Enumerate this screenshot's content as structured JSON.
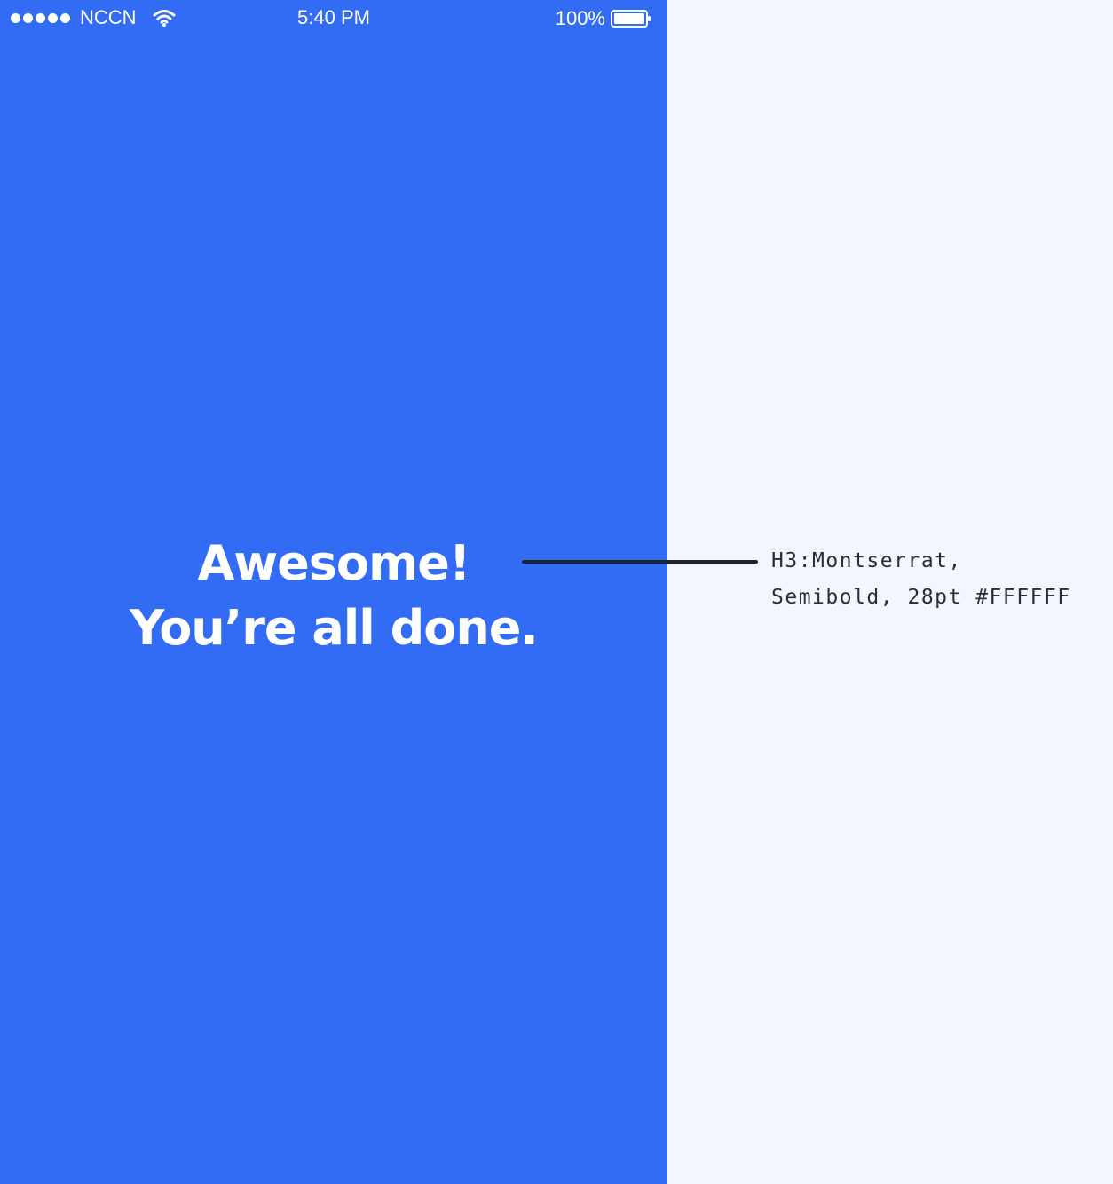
{
  "status_bar": {
    "carrier": "NCCN",
    "time": "5:40 PM",
    "battery_percent": "100%",
    "signal_icon": "signal-dots-icon",
    "wifi_icon": "wifi-icon",
    "battery_icon": "battery-full-icon"
  },
  "screen": {
    "background_color": "#336CF4",
    "headline_line1": "Awesome!",
    "headline_line2": "You’re all done."
  },
  "annotation": {
    "line1": "H3:Montserrat,",
    "line2": "Semibold, 28pt #FFFFFF"
  },
  "colors": {
    "panel_background": "#F3F6FE",
    "text_on_screen": "#FFFFFF",
    "annotation_text": "#2A2E38"
  }
}
